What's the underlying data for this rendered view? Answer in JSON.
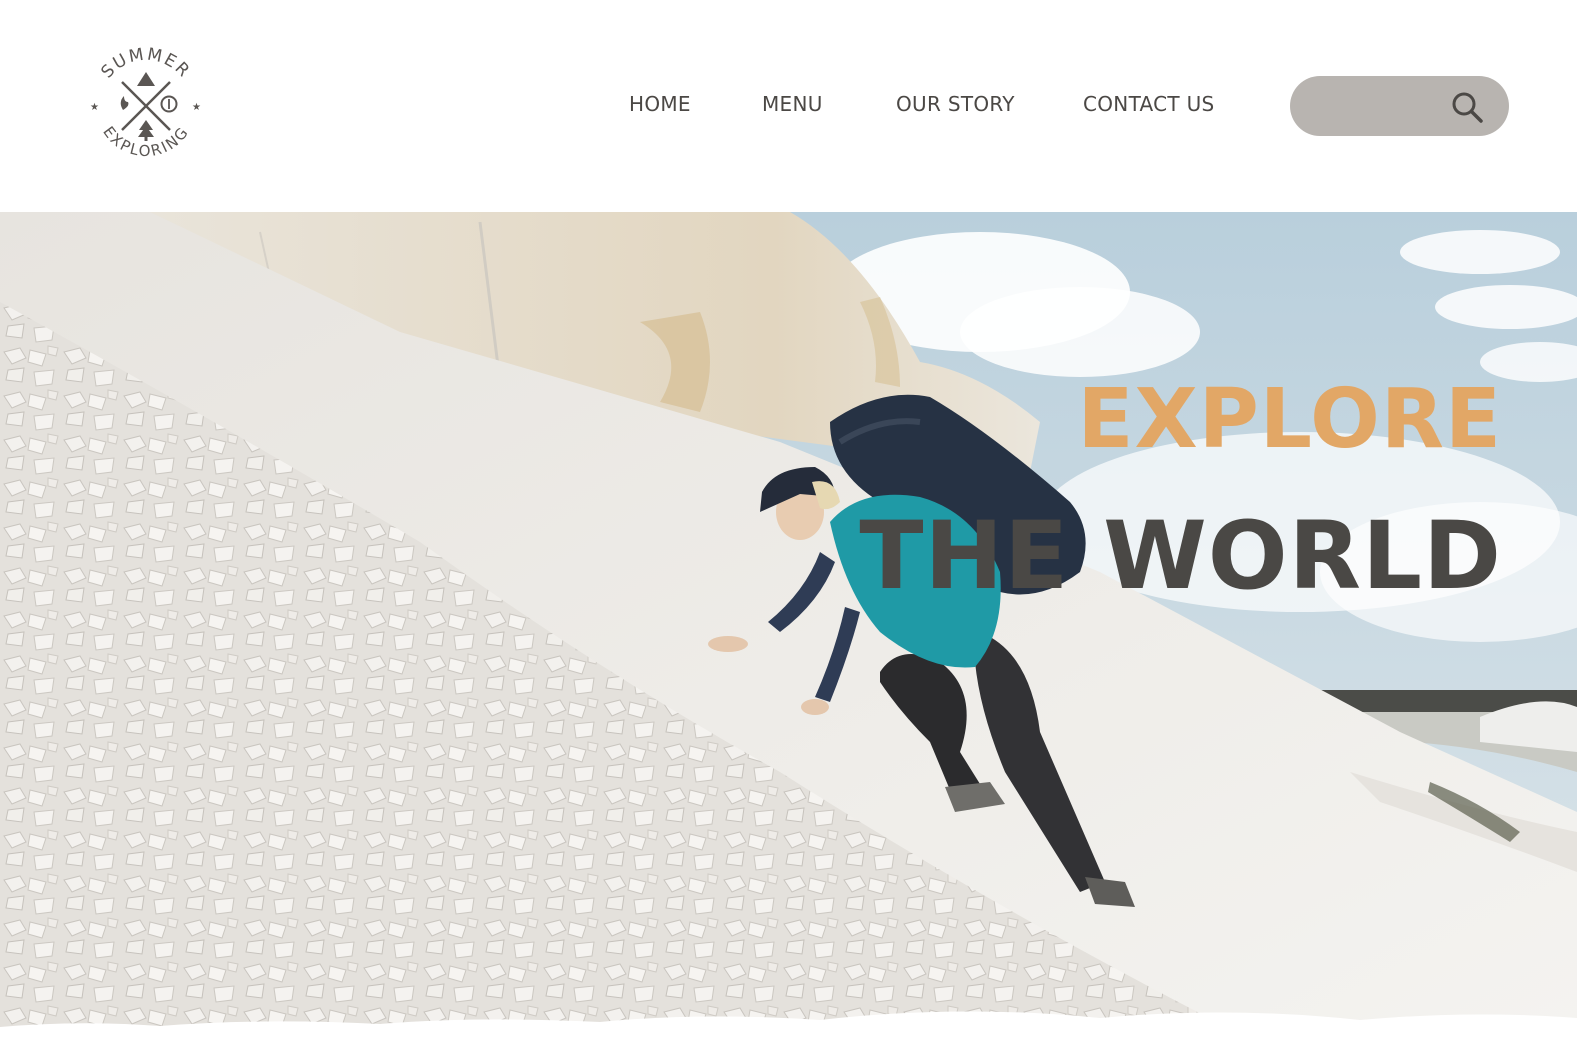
{
  "brand": {
    "logo_top_text": "SUMMER",
    "logo_bottom_text": "EXPLORING",
    "icon": "camping-emblem-icon"
  },
  "nav": {
    "items": [
      {
        "label": "HOME"
      },
      {
        "label": "MENU"
      },
      {
        "label": "OUR STORY"
      },
      {
        "label": "CONTACT US"
      }
    ]
  },
  "search": {
    "placeholder": "",
    "value": "",
    "icon": "search-icon"
  },
  "hero": {
    "line1": "EXPLORE",
    "line2": "THE WORLD",
    "image": "hiker-climbing-white-rock-slope"
  },
  "colors": {
    "accent": "#e2a766",
    "headline_dark": "#4a4845",
    "nav_text": "#4b4845",
    "search_bg": "#b8b4b0",
    "sky": "#c7d8e2"
  }
}
